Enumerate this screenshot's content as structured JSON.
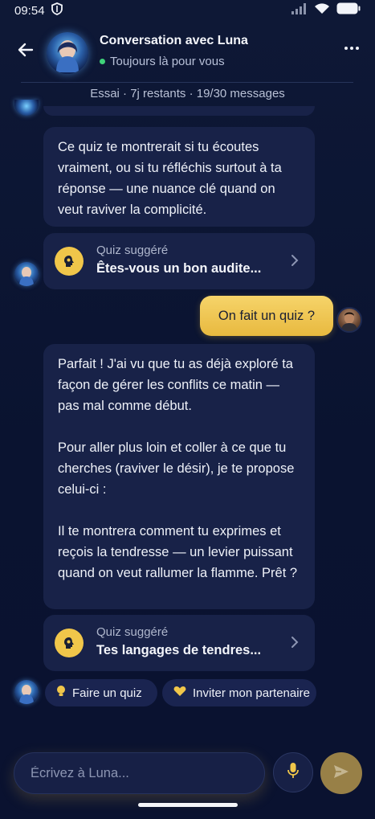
{
  "status_bar": {
    "time": "09:54"
  },
  "header": {
    "title": "Conversation avec Luna",
    "subtitle": "Toujours là pour vous"
  },
  "trial_banner": "Essai · 7j restants · 19/30 messages",
  "messages": {
    "bot_1": "Ce quiz te montrerait si tu écoutes vraiment, ou si tu réfléchis surtout à ta réponse — une nuance clé quand on veut raviver la complicité.",
    "quiz_1": {
      "label": "Quiz suggéré",
      "title": "Êtes-vous un bon audite..."
    },
    "user_1": "On fait un quiz ?",
    "bot_2_p1": "Parfait ! J'ai vu que tu as déjà exploré ta façon de gérer les conflits ce matin — pas mal comme début.",
    "bot_2_p2": "Pour aller plus loin et coller à ce que tu cherches (raviver le désir), je te propose celui-ci :",
    "bot_2_p3": "Il te montrera comment tu exprimes et reçois la tendresse — un levier puissant quand on veut rallumer la flamme. Prêt ?",
    "quiz_2": {
      "label": "Quiz suggéré",
      "title": "Tes langages de tendres..."
    }
  },
  "quick_replies": {
    "quiz": "Faire un quiz",
    "invite": "Inviter mon partenaire"
  },
  "composer": {
    "placeholder": "Écrivez à Luna..."
  },
  "colors": {
    "background": "#0b1330",
    "bubble": "#182248",
    "accent_gold": "#f0c64a",
    "online": "#3fd27a"
  }
}
